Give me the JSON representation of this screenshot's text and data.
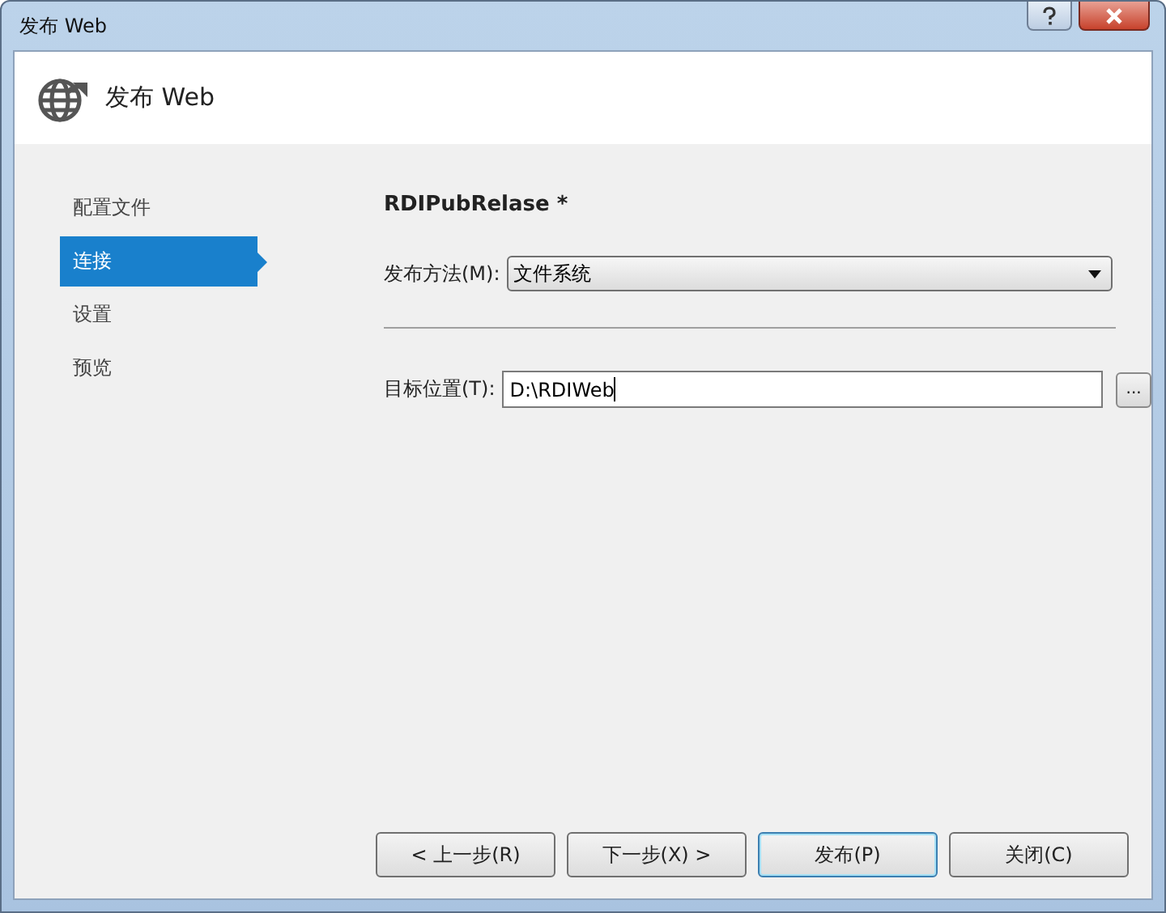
{
  "window": {
    "title": "发布 Web"
  },
  "header": {
    "title": "发布 Web"
  },
  "sidebar": {
    "items": [
      {
        "label": "配置文件",
        "selected": false
      },
      {
        "label": "连接",
        "selected": true
      },
      {
        "label": "设置",
        "selected": false
      },
      {
        "label": "预览",
        "selected": false
      }
    ]
  },
  "profile_name": "RDIPubRelase *",
  "publish_method": {
    "label": "发布方法(M):",
    "value": "文件系统"
  },
  "target_location": {
    "label": "目标位置(T):",
    "value": "D:\\RDIWeb",
    "browse": "..."
  },
  "buttons": [
    {
      "label": "< 上一步(R)",
      "default": false
    },
    {
      "label": "下一步(X) >",
      "default": false
    },
    {
      "label": "发布(P)",
      "default": true
    },
    {
      "label": "关闭(C)",
      "default": false
    }
  ]
}
